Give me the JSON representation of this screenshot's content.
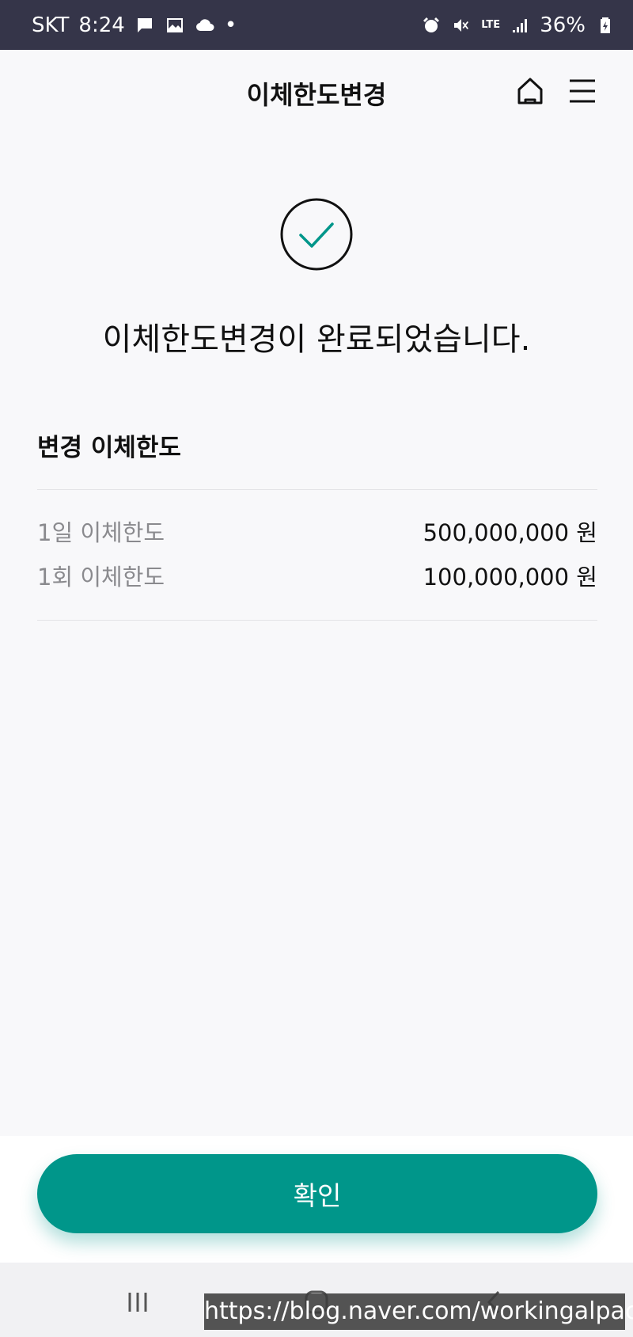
{
  "status_bar": {
    "carrier": "SKT",
    "time": "8:24",
    "network": "LTE",
    "battery": "36%"
  },
  "header": {
    "title": "이체한도변경",
    "home_icon": "home-icon",
    "menu_icon": "hamburger-menu-icon"
  },
  "result": {
    "icon": "check-circle-icon",
    "message": "이체한도변경이 완료되었습니다."
  },
  "details": {
    "title": "변경 이체한도",
    "rows": [
      {
        "label": "1일 이체한도",
        "value": "500,000,000 원"
      },
      {
        "label": "1회 이체한도",
        "value": "100,000,000 원"
      }
    ]
  },
  "actions": {
    "confirm_label": "확인"
  },
  "colors": {
    "accent": "#00968a",
    "status_bar": "#353549"
  },
  "watermark": {
    "text": "https://blog.naver.com/workingalpaca"
  }
}
